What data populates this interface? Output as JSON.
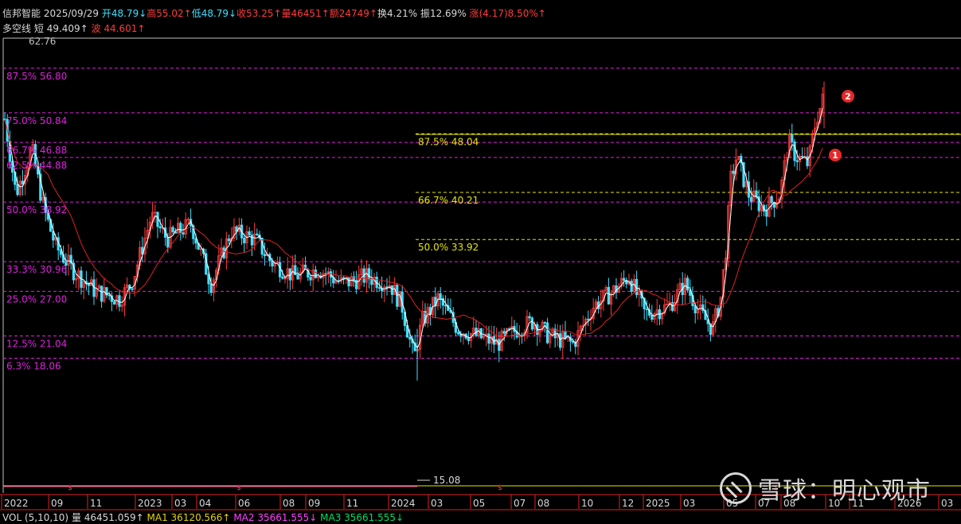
{
  "stock": {
    "name": "信邦智能",
    "date": "2025/09/29",
    "open": "开48.79↓",
    "high": "高55.02↑",
    "low": "低48.79↓",
    "close": "收53.25↑",
    "volume": "量46451↑",
    "amount": "额24749↑",
    "turnover": "换4.21%",
    "amplitude": "振12.69%",
    "change_label": "涨",
    "change": "(4.17)8.50%↑"
  },
  "indicator": {
    "name": "多空线",
    "short_label": "短",
    "short_value": "49.409↑",
    "wave_label": "波",
    "wave_value": "44.601↑"
  },
  "levels_left": [
    {
      "label": "87.5% 56.80",
      "price": 56.8
    },
    {
      "label": "75.0% 50.84",
      "price": 50.84
    },
    {
      "label": "66.7% 46.88",
      "price": 46.88
    },
    {
      "label": "62.5% 44.88",
      "price": 44.88
    },
    {
      "label": "50.0% 38.92",
      "price": 38.92
    },
    {
      "label": "33.3% 30.96",
      "price": 30.96
    },
    {
      "label": "25.0% 27.00",
      "price": 27.0
    },
    {
      "label": "12.5% 21.04",
      "price": 21.04
    },
    {
      "label": "6.3% 18.06",
      "price": 18.06
    }
  ],
  "levels_right": [
    {
      "label": "87.5% 48.04",
      "price": 48.04
    },
    {
      "label": "66.7% 40.21",
      "price": 40.21
    },
    {
      "label": "50.0% 33.92",
      "price": 33.92
    }
  ],
  "top_price": "62.76",
  "low_price": "15.08",
  "x_axis": [
    "2022",
    "09",
    "11",
    "2023",
    "03",
    "04",
    "06",
    "08",
    "09",
    "11",
    "2024",
    "03",
    "05",
    "07",
    "08",
    "10",
    "12",
    "2025",
    "03",
    "05",
    "07",
    "08",
    "10",
    "11",
    "2026",
    "03"
  ],
  "markers": [
    "1",
    "2"
  ],
  "volume_line": {
    "title": "VOL (5,10,10)",
    "vol": "量 46451.059↑",
    "ma1": "MA1 36120.566↑",
    "ma2": "MA2 35661.555↓",
    "ma3": "MA3 35661.555↓"
  },
  "watermark": "雪球：明心观市",
  "colors": {
    "up": "#ff3b3b",
    "down": "#40e0ff",
    "ma_short": "#ffffff",
    "ma_long": "#e02020",
    "fib_left": "#e020e0",
    "fib_right": "#e6e600"
  }
}
